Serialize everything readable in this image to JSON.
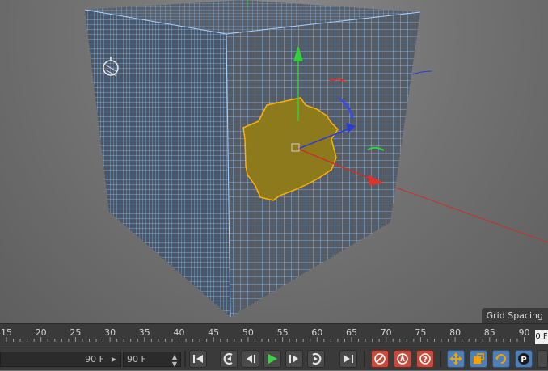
{
  "viewport": {
    "grid_spacing_label": "Grid Spacing"
  },
  "ruler": {
    "ticks": [
      "15",
      "20",
      "25",
      "30",
      "35",
      "40",
      "45",
      "50",
      "55",
      "60",
      "65",
      "70",
      "75",
      "80",
      "85",
      "90"
    ],
    "current_frame": "0 F"
  },
  "transport": {
    "end_frame_value": "90 F",
    "max_frame_value": "90 F"
  },
  "icons": {
    "go_start": "go-to-start-icon",
    "prev_key": "previous-keyframe-icon",
    "prev_frame": "previous-frame-icon",
    "play": "play-forward-icon",
    "next_frame": "next-frame-icon",
    "next_key": "next-keyframe-icon",
    "go_end": "go-to-end-icon",
    "record": "record-active-objects-icon",
    "autokey": "autokeying-icon",
    "keyframe_sel": "keyframe-selection-icon",
    "pos": "record-position-icon",
    "scale": "record-scale-icon",
    "rot": "record-rotation-icon",
    "param": "record-parameter-icon"
  },
  "colors": {
    "selection_fill": "#8c7a1d",
    "selection_edge": "#ffb000",
    "mesh_edge": "#8fc4ff",
    "axis_x": "#d8362b",
    "axis_y": "#2fd03a",
    "axis_z": "#2a3cd8"
  }
}
